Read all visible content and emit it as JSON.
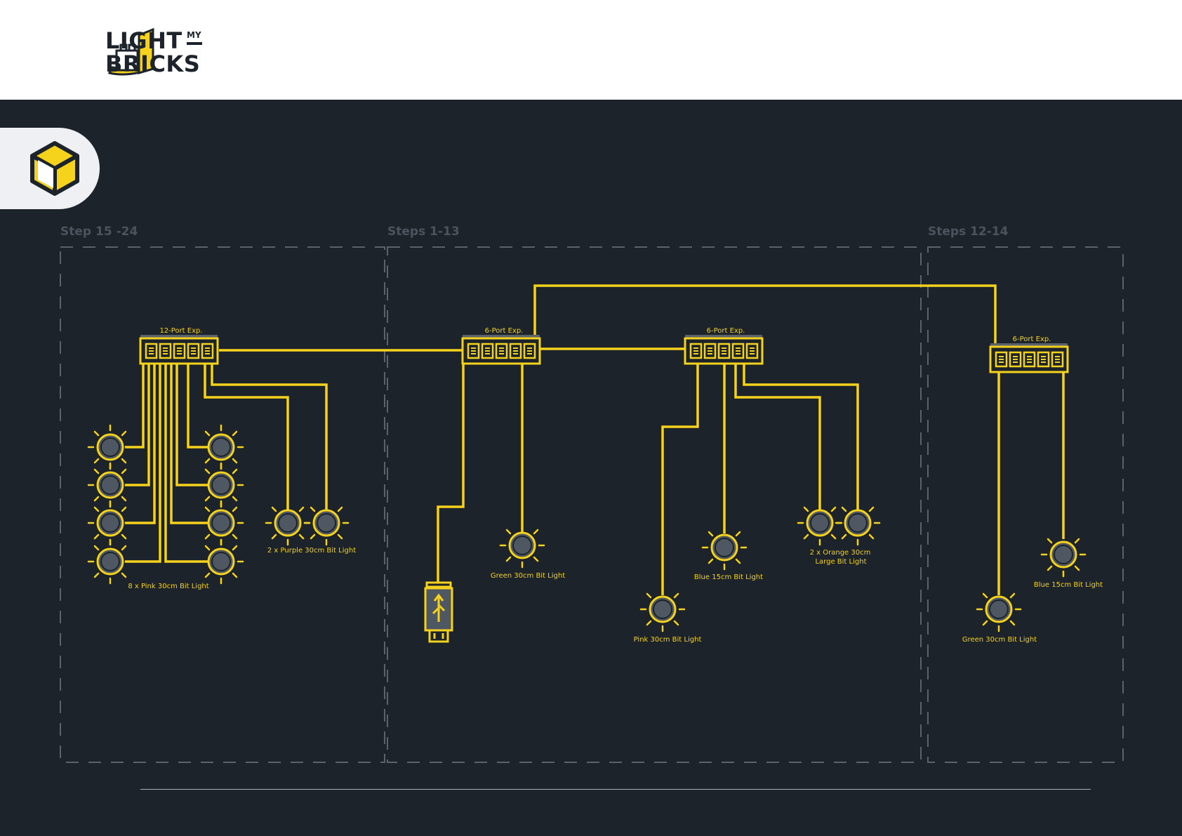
{
  "brand": {
    "line1": "LIGHT",
    "line2": "BRICKS",
    "small": "MY"
  },
  "icons": {
    "logo": "brick-bulb-logo-icon",
    "section": "cube-icon",
    "light": "bit-light-icon",
    "usb": "usb-connector-icon",
    "expander": "port-expander-icon"
  },
  "colors": {
    "background": "#1c232b",
    "wire": "#f5d21b",
    "light_fill": "#4f5862",
    "step_label": "#4b545d",
    "dash": "#5a636c"
  },
  "steps": [
    {
      "label": "Step 15 -24"
    },
    {
      "label": "Steps 1-13"
    },
    {
      "label": "Steps 12-14"
    }
  ],
  "expanders": [
    {
      "label": "12-Port Exp."
    },
    {
      "label": "6-Port Exp."
    },
    {
      "label": "6-Port Exp."
    },
    {
      "label": "6-Port Exp."
    }
  ],
  "light_labels": [
    {
      "text": "8 x Pink 30cm Bit Light"
    },
    {
      "text": "2 x Purple 30cm Bit Light"
    },
    {
      "text": "Green 30cm Bit Light"
    },
    {
      "text": "Pink 30cm Bit Light"
    },
    {
      "text": "Blue 15cm Bit Light"
    },
    {
      "text": "2 x Orange 30cm"
    },
    {
      "text": "Large Bit Light"
    },
    {
      "text": "Green 30cm Bit Light"
    },
    {
      "text": "Blue 15cm Bit Light"
    }
  ]
}
